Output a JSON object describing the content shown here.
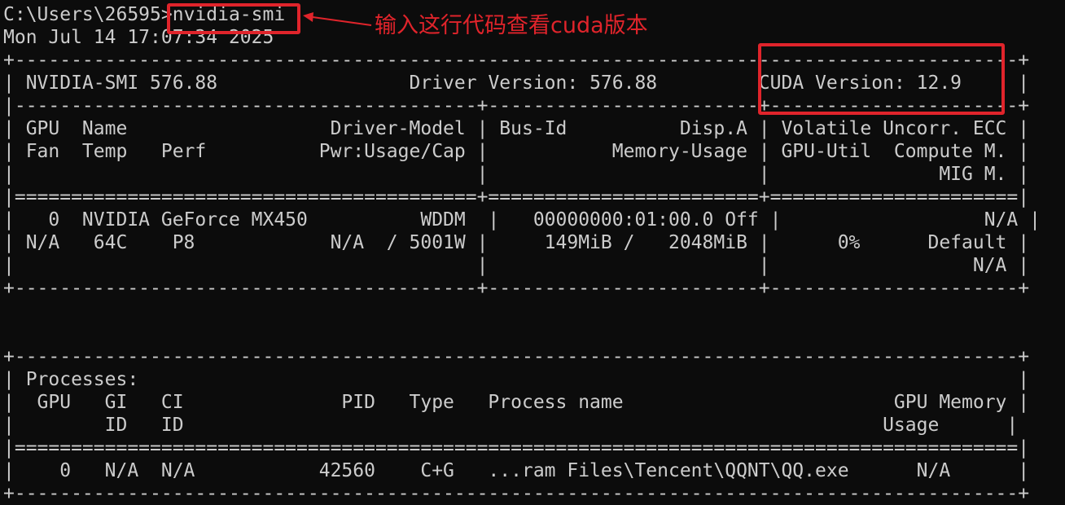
{
  "terminal": {
    "prompt": "C:\\Users\\26595>",
    "command": "nvidia-smi",
    "timestamp": "Mon Jul 14 17:07:34 2025",
    "header": {
      "smi_version": "NVIDIA-SMI 576.88",
      "driver_version": "Driver Version: 576.88",
      "cuda_version": "CUDA Version: 12.9"
    },
    "gpu_table": {
      "column_headers": [
        "| GPU  Name                  Driver-Model | Bus-Id          Disp.A | Volatile Uncorr. ECC |",
        "| Fan  Temp   Perf          Pwr:Usage/Cap |           Memory-Usage | GPU-Util  Compute M. |",
        "|                                         |                        |               MIG M. |"
      ],
      "rows": [
        "|   0  NVIDIA GeForce MX450          WDDM  |   00000000:01:00.0 Off |                  N/A |",
        "| N/A   64C    P8            N/A  / 5001W |     149MiB /   2048MiB |      0%      Default |",
        "|                                         |                        |                  N/A |"
      ]
    },
    "processes_table": {
      "title": "| Processes:                                                                              |",
      "column_headers": [
        "|  GPU   GI   CI              PID   Type   Process name                        GPU Memory |",
        "|        ID   ID                                                              Usage      |"
      ],
      "rows": [
        "|    0   N/A  N/A           42560    C+G   ...ram Files\\Tencent\\QQNT\\QQ.exe      N/A      |"
      ]
    }
  },
  "annotation": {
    "text": "输入这行代码查看cuda版本",
    "color": "#e0242b"
  }
}
